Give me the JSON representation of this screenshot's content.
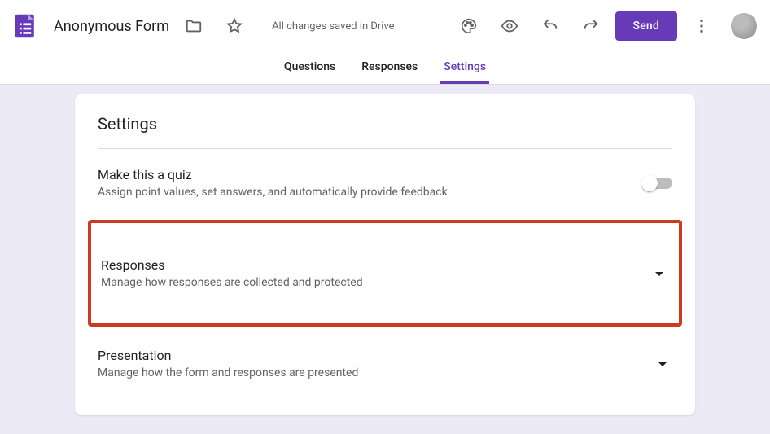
{
  "header": {
    "form_title": "Anonymous Form",
    "save_status": "All changes saved in Drive",
    "send_label": "Send"
  },
  "tabs": {
    "questions": "Questions",
    "responses": "Responses",
    "settings": "Settings"
  },
  "settings": {
    "page_title": "Settings",
    "quiz": {
      "title": "Make this a quiz",
      "desc": "Assign point values, set answers, and automatically provide feedback"
    },
    "responses": {
      "title": "Responses",
      "desc": "Manage how responses are collected and protected"
    },
    "presentation": {
      "title": "Presentation",
      "desc": "Manage how the form and responses are presented"
    }
  }
}
